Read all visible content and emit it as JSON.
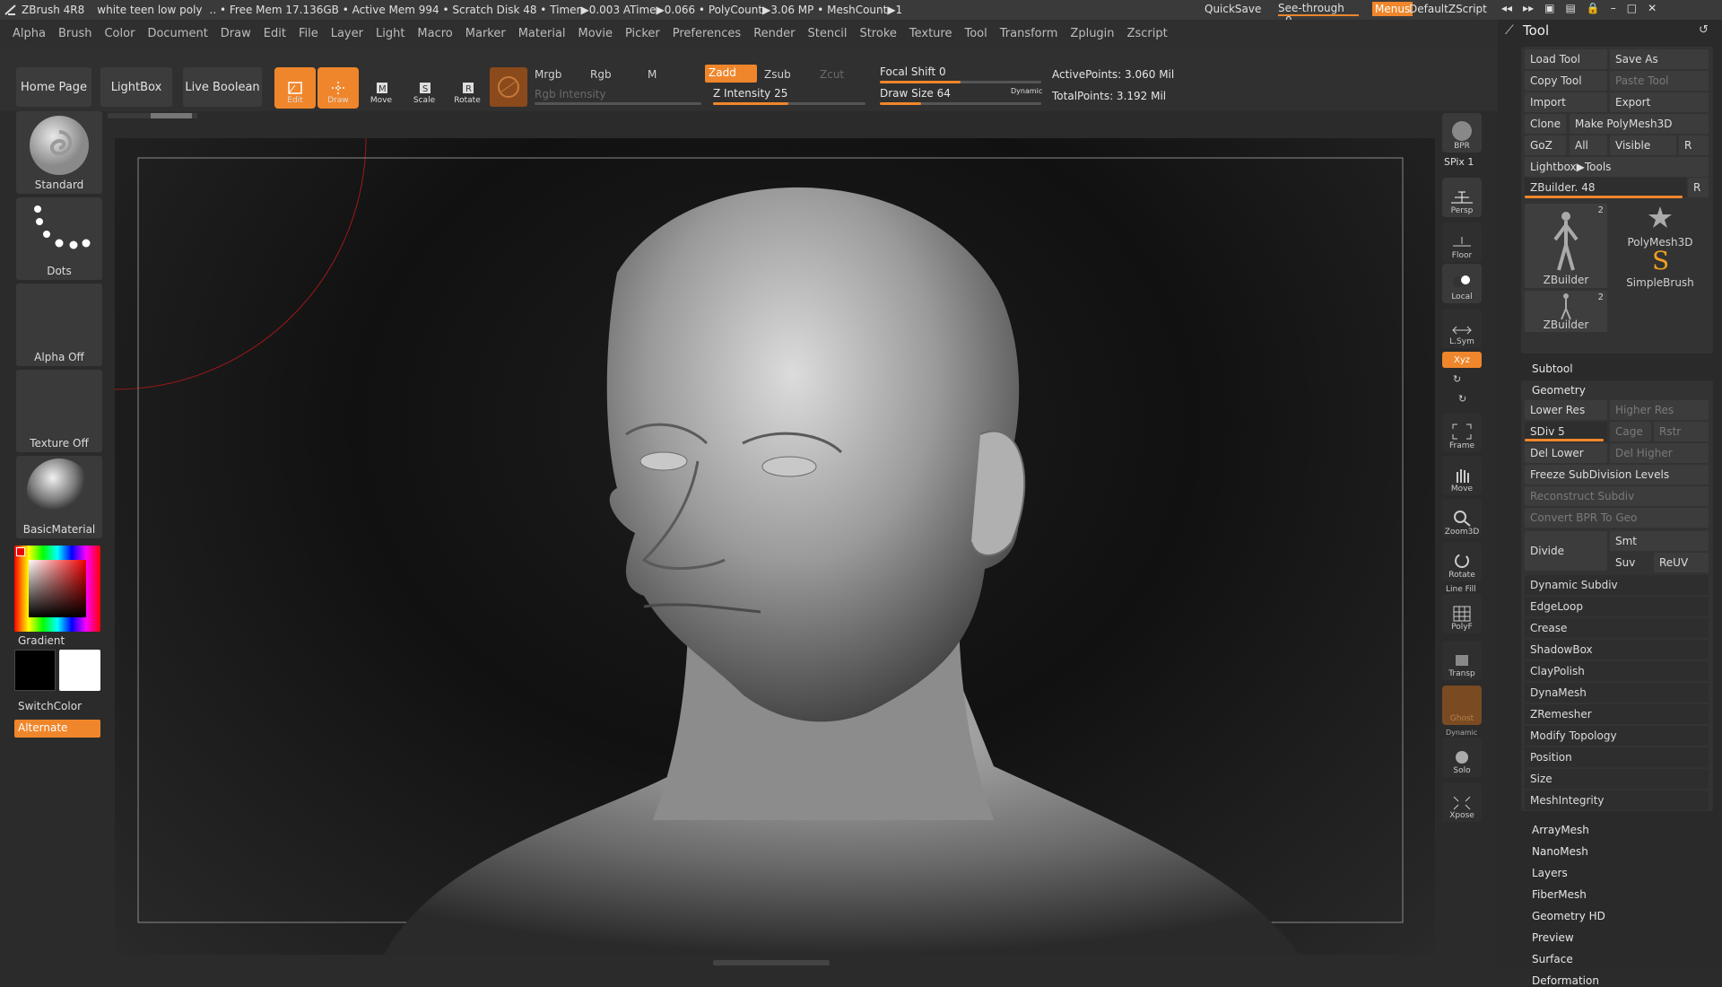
{
  "titlebar": {
    "app": "ZBrush 4R8",
    "doc": "white teen low poly",
    "info": "..  • Free Mem 17.136GB • Active Mem 994 • Scratch Disk 48 • Timer▶0.003 ATime▶0.066 • PolyCount▶3.06 MP • MeshCount▶1",
    "quicksave": "QuickSave",
    "seethrough": "See-through",
    "seethrough_val": "0",
    "menus": "Menus",
    "script": "DefaultZScript"
  },
  "menu": [
    "Alpha",
    "Brush",
    "Color",
    "Document",
    "Draw",
    "Edit",
    "File",
    "Layer",
    "Light",
    "Macro",
    "Marker",
    "Material",
    "Movie",
    "Picker",
    "Preferences",
    "Render",
    "Stencil",
    "Stroke",
    "Texture",
    "Tool",
    "Transform",
    "Zplugin",
    "Zscript"
  ],
  "shelf": {
    "home": "Home Page",
    "lightbox": "LightBox",
    "liveboolean": "Live Boolean",
    "edit": "Edit",
    "draw": "Draw",
    "move": "Move",
    "scale": "Scale",
    "rotate": "Rotate",
    "mrgb": "Mrgb",
    "rgb": "Rgb",
    "m": "M",
    "rgb_intensity": "Rgb Intensity",
    "zadd": "Zadd",
    "zsub": "Zsub",
    "zcut": "Zcut",
    "z_intensity": "Z Intensity 25",
    "focal": "Focal Shift 0",
    "drawsize": "Draw Size 64",
    "dynamic": "Dynamic",
    "active_points": "ActivePoints: 3.060 Mil",
    "total_points": "TotalPoints: 3.192 Mil"
  },
  "left": {
    "brush": "Standard",
    "stroke": "Dots",
    "alpha": "Alpha Off",
    "texture": "Texture Off",
    "material": "BasicMaterial",
    "gradient": "Gradient",
    "switchcolor": "SwitchColor",
    "alternate": "Alternate"
  },
  "right": {
    "bpr": "BPR",
    "spix": "SPix 1",
    "persp": "Persp",
    "dynamic": "Dynamic",
    "floor": "Floor",
    "local": "Local",
    "lsym": "L.Sym",
    "xyz": "Xyz",
    "frame": "Frame",
    "move": "Move",
    "zoom": "Zoom3D",
    "rotate": "Rotate",
    "linefill": "Line Fill",
    "polyf": "PolyF",
    "transp": "Transp",
    "ghost": "Ghost",
    "solo": "Solo",
    "xpose": "Xpose"
  },
  "tool": {
    "title": "Tool",
    "load": "Load Tool",
    "saveas": "Save As",
    "copy": "Copy Tool",
    "paste": "Paste Tool",
    "import": "Import",
    "export": "Export",
    "clone": "Clone",
    "makepoly": "Make PolyMesh3D",
    "goz": "GoZ",
    "all": "All",
    "visible": "Visible",
    "r": "R",
    "lightbox_tools": "Lightbox▶Tools",
    "zbuilder": "ZBuilder. 48",
    "thumb1": "ZBuilder",
    "thumb1_count": "2",
    "thumb2": "PolyMesh3D",
    "thumb3": "SimpleBrush",
    "thumb4": "ZBuilder",
    "thumb4_count": "2",
    "subtool": "Subtool",
    "geometry": "Geometry",
    "lowerres": "Lower Res",
    "higherres": "Higher Res",
    "sdiv": "SDiv 5",
    "cage": "Cage",
    "rstr": "Rstr",
    "dellower": "Del Lower",
    "delhigher": "Del Higher",
    "freeze": "Freeze SubDivision Levels",
    "reconstruct": "Reconstruct Subdiv",
    "convertbpr": "Convert BPR To Geo",
    "divide": "Divide",
    "smt": "Smt",
    "suv": "Suv",
    "reuv": "ReUV",
    "geo_items": [
      "Dynamic Subdiv",
      "EdgeLoop",
      "Crease",
      "ShadowBox",
      "ClayPolish",
      "DynaMesh",
      "ZRemesher",
      "Modify Topology",
      "Position",
      "Size",
      "MeshIntegrity"
    ],
    "lower_items": [
      "ArrayMesh",
      "NanoMesh",
      "Layers",
      "FiberMesh",
      "Geometry HD",
      "Preview",
      "Surface",
      "Deformation"
    ]
  }
}
